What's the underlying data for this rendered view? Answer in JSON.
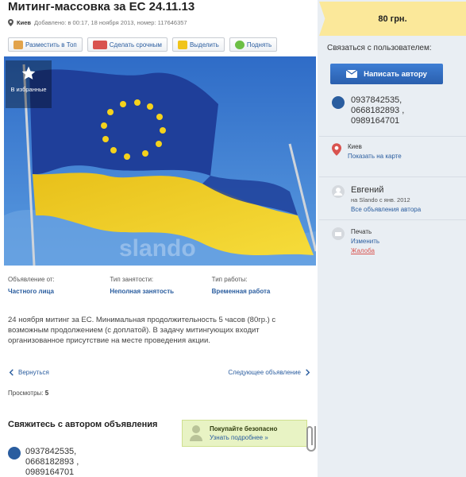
{
  "listing": {
    "title": "Митинг-массовка за ЕС 24.11.13",
    "city": "Киев",
    "added": "Добавлено: в 00:17, 18 ноября 2013, номер: 117646357"
  },
  "actions": {
    "top": "Разместить в Топ",
    "urgent": "Сделать срочным",
    "highlight": "Выделить",
    "raise": "Поднять"
  },
  "favorite_label": "В избранные",
  "watermark": "slando",
  "fields": [
    {
      "label": "Объявление от:",
      "value": "Частного лица"
    },
    {
      "label": "Тип занятости:",
      "value": "Неполная занятость"
    },
    {
      "label": "Тип работы:",
      "value": "Временная работа"
    }
  ],
  "description": "24 ноября митинг за ЕС. Минимальная продолжительность 5 часов (80гр.) с возможным продолжением (с доплатой). В задачу митингующих входит организованное присутствие на месте проведения акции.",
  "nav": {
    "back": "Вернуться",
    "next": "Следующее объявление"
  },
  "views": {
    "label": "Просмотры:",
    "count": "5"
  },
  "contact_section": {
    "title": "Свяжитесь с автором объявления",
    "phones": "0937842535,\n0668182893 ,\n0989164701"
  },
  "safe_buy": {
    "title": "Покупайте безопасно",
    "link": "Узнать подробнее »"
  },
  "sidebar": {
    "price": "80 грн.",
    "contact_label": "Связаться с пользователем:",
    "write_button": "Написать автору",
    "phones": "0937842535,\n0668182893 ,\n0989164701",
    "city": "Киев",
    "map_link": "Показать на карте",
    "user_name": "Евгений",
    "since": "на Slando с янв. 2012",
    "all_ads": "Все объявления автора",
    "print": "Печать",
    "edit": "Изменить",
    "report": "Жалоба"
  },
  "colors": {
    "link": "#2a5d9f",
    "price_bg": "#fbe89a",
    "button": "#3e7ed4",
    "eu_blue": "#1f3f9a",
    "ua_yellow": "#f4d21c"
  }
}
